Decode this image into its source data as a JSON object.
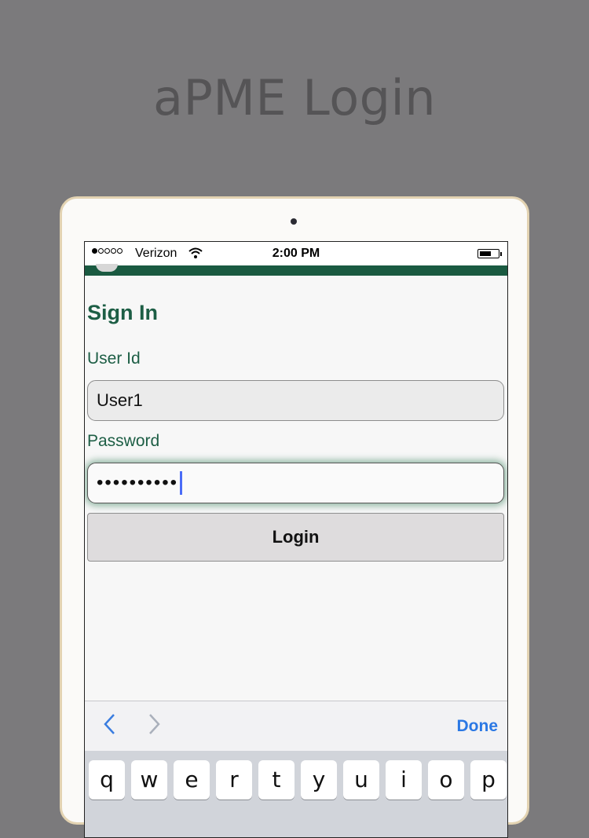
{
  "promo": {
    "title": "aPME Login"
  },
  "status_bar": {
    "carrier": "Verizon",
    "time": "2:00 PM",
    "signal_bars_filled": 1,
    "signal_bars_total": 5
  },
  "form": {
    "title": "Sign In",
    "user_label": "User Id",
    "user_value": "User1",
    "password_label": "Password",
    "password_value": "••••••••••",
    "login_label": "Login"
  },
  "toolbar": {
    "prev_icon": "chevron-left-icon",
    "next_icon": "chevron-right-icon",
    "done_label": "Done"
  },
  "keyboard": {
    "keys": [
      "q",
      "w",
      "e",
      "r",
      "t",
      "y",
      "u",
      "i",
      "o",
      "p"
    ]
  },
  "colors": {
    "brand_green": "#1a5a41",
    "accent_blue": "#2b78e4",
    "background": "#7b7a7c"
  }
}
